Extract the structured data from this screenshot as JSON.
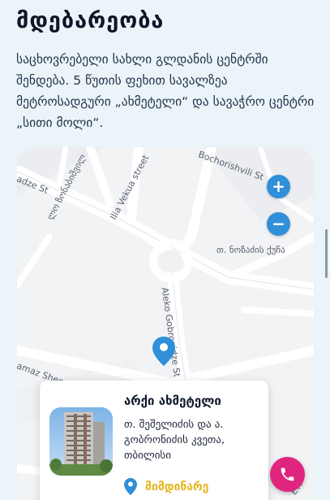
{
  "section": {
    "title": "მდებარეობა",
    "description": "საცხოვრებელი სახლი გლდანის ცენტრში შენდება. 5 წუთის ფეხით სავალზეა მეტროსადგური „ახმეტელი“ და სავაჭრო ცენტრი „სითი მოლი“."
  },
  "map": {
    "streets": {
      "ramaz_shengelia_top": "adze St",
      "georgian_street_1": "ლო ზონაბიშვილ",
      "ilia_vekua": "Ilia Vekua street",
      "bochorishvili": "Bochorishvili St",
      "nozadze": "თ. ნოზაძის ქუჩა",
      "aleko_gobronidze": "Aleko Gobronidze St",
      "ramaz_shengelia": "amaz Shen",
      "corner_right": "ETI"
    },
    "zoom_in_label": "+",
    "zoom_out_label": "−"
  },
  "project_card": {
    "title": "არქი ახმეტელი",
    "address": "თ. შეშელიძის და ა. გობრონიძის კვეთა, თბილისი",
    "status": "მიმდინარე"
  },
  "colors": {
    "accent_blue": "#2f8fd8",
    "status_yellow": "#e3b51f",
    "call_pink": "#e0257f"
  }
}
